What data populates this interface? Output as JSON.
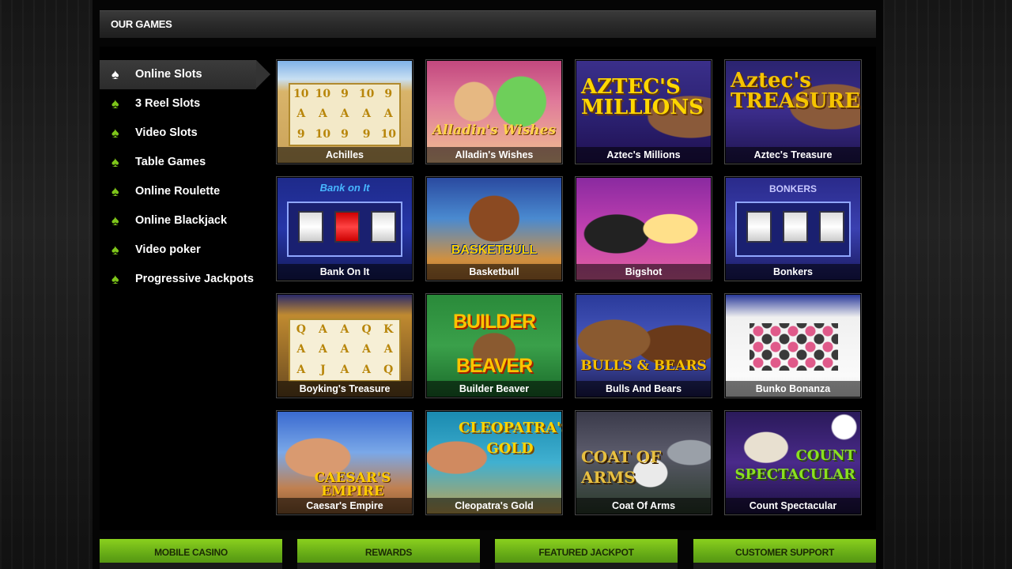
{
  "section": {
    "title": "OUR GAMES"
  },
  "sidebar": {
    "items": [
      {
        "label": "Online Slots",
        "active": true
      },
      {
        "label": "3 Reel Slots"
      },
      {
        "label": "Video Slots"
      },
      {
        "label": "Table Games"
      },
      {
        "label": "Online Roulette"
      },
      {
        "label": "Online Blackjack"
      },
      {
        "label": "Video poker"
      },
      {
        "label": "Progressive Jackpots"
      }
    ],
    "bullet_icon": "spade-icon"
  },
  "games": [
    {
      "name": "Achilles",
      "art_text": ""
    },
    {
      "name": "Alladin's Wishes",
      "art_text": "Alladin's Wishes"
    },
    {
      "name": "Aztec's Millions",
      "art_text": "AZTEC'S MILLIONS"
    },
    {
      "name": "Aztec's Treasure",
      "art_text": "Aztec's TREASURE"
    },
    {
      "name": "Bank On It",
      "art_text": "Bank on It"
    },
    {
      "name": "Basketbull",
      "art_text": "BASKETBULL"
    },
    {
      "name": "Bigshot",
      "art_text": ""
    },
    {
      "name": "Bonkers",
      "art_text": "BONKERS"
    },
    {
      "name": "Boyking's Treasure",
      "art_text": ""
    },
    {
      "name": "Builder Beaver",
      "art_text": "BUILDER BEAVER"
    },
    {
      "name": "Bulls And Bears",
      "art_text": "BULLS & BEARS"
    },
    {
      "name": "Bunko Bonanza",
      "art_text": ""
    },
    {
      "name": "Caesar's Empire",
      "art_text": "CAESAR'S EMPIRE"
    },
    {
      "name": "Cleopatra's Gold",
      "art_text": "CLEOPATRA'S GOLD"
    },
    {
      "name": "Coat Of Arms",
      "art_text": "COAT OF ARMS"
    },
    {
      "name": "Count Spectacular",
      "art_text": "COUNT SPECTACULAR"
    }
  ],
  "footer": {
    "tabs": [
      "MOBILE CASINO",
      "REWARDS",
      "FEATURED JACKPOT",
      "CUSTOMER SUPPORT"
    ]
  },
  "colors": {
    "accent_green": "#7ec61a",
    "tab_green": "#6bb618"
  }
}
